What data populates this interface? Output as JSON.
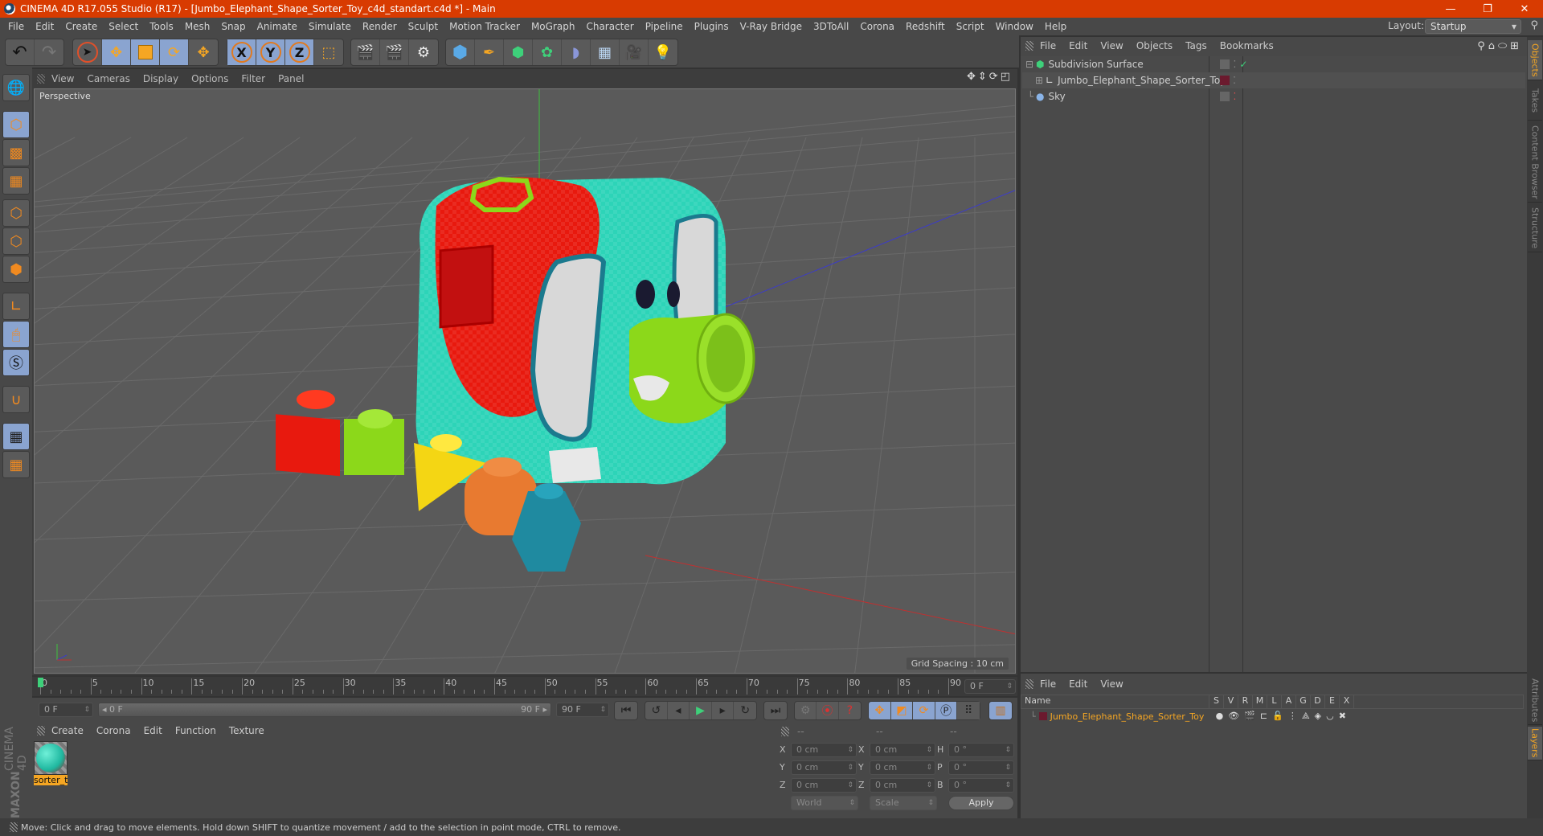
{
  "window": {
    "title": "CINEMA 4D R17.055 Studio (R17) - [Jumbo_Elephant_Shape_Sorter_Toy_c4d_standart.c4d *] - Main",
    "minimize": "—",
    "restore": "❐",
    "close": "✕"
  },
  "menubar": {
    "items": [
      "File",
      "Edit",
      "Create",
      "Select",
      "Tools",
      "Mesh",
      "Snap",
      "Animate",
      "Simulate",
      "Render",
      "Sculpt",
      "Motion Tracker",
      "MoGraph",
      "Character",
      "Pipeline",
      "Plugins",
      "V-Ray Bridge",
      "3DToAll",
      "Corona",
      "Redshift",
      "Script",
      "Window",
      "Help"
    ],
    "layout_label": "Layout:",
    "layout_value": "Startup"
  },
  "toolbar": {
    "undo": "undo-icon",
    "redo": "redo-icon",
    "tools": [
      "live-selection",
      "move",
      "scale",
      "rotate",
      "last-used"
    ],
    "axis_x": "X",
    "axis_y": "Y",
    "axis_z": "Z",
    "coord_system": "world-coordinates",
    "render": [
      "render-view",
      "render-picture-viewer",
      "render-settings"
    ],
    "create": [
      "cube",
      "pen",
      "subdivision",
      "cloner",
      "deformer",
      "floor",
      "camera",
      "light"
    ]
  },
  "left_tools": [
    "make-editable",
    "model-mode",
    "texture-mode",
    "workplane-mode",
    "points-mode",
    "edges-mode",
    "polygons-mode",
    "axis-mode",
    "tweak-mode",
    "solo-mode",
    "snap",
    "lock-workplane",
    "planar-workplane"
  ],
  "viewport": {
    "menu": [
      "View",
      "Cameras",
      "Display",
      "Options",
      "Filter",
      "Panel"
    ],
    "label": "Perspective",
    "grid_spacing": "Grid Spacing : 10 cm",
    "axis_y": "y",
    "axis_z": "z"
  },
  "timeline": {
    "ticks": [
      "0",
      "5",
      "10",
      "15",
      "20",
      "25",
      "30",
      "35",
      "40",
      "45",
      "50",
      "55",
      "60",
      "65",
      "70",
      "75",
      "80",
      "85",
      "90"
    ],
    "current_frame": "0 F",
    "start_field": "0 F",
    "range_start": "0 F",
    "range_end": "90 F",
    "end_field": "90 F",
    "playhead_fraction": 0
  },
  "materials": {
    "menu": [
      "Create",
      "Corona",
      "Edit",
      "Function",
      "Texture"
    ],
    "items": [
      {
        "name": "sorter_t"
      }
    ],
    "brand_top": "MAXON",
    "brand_bottom": "CINEMA 4D"
  },
  "coords": {
    "headers": [
      "--",
      "--",
      "--"
    ],
    "rows": [
      {
        "a": "X",
        "av": "0 cm",
        "b": "X",
        "bv": "0 cm",
        "c": "H",
        "cv": "0 °"
      },
      {
        "a": "Y",
        "av": "0 cm",
        "b": "Y",
        "bv": "0 cm",
        "c": "P",
        "cv": "0 °"
      },
      {
        "a": "Z",
        "av": "0 cm",
        "b": "Z",
        "bv": "0 cm",
        "c": "B",
        "cv": "0 °"
      }
    ],
    "space": "World",
    "mode": "Scale",
    "apply": "Apply"
  },
  "object_manager": {
    "menu": [
      "File",
      "Edit",
      "View",
      "Objects",
      "Tags",
      "Bookmarks"
    ],
    "objects": [
      {
        "name": "Subdivision Surface",
        "indent": 0
      },
      {
        "name": "Jumbo_Elephant_Shape_Sorter_Toy",
        "indent": 1
      },
      {
        "name": "Sky",
        "indent": 0
      }
    ]
  },
  "layer_manager": {
    "menu": [
      "File",
      "Edit",
      "View"
    ],
    "columns": [
      "Name",
      "S",
      "V",
      "R",
      "M",
      "L",
      "A",
      "G",
      "D",
      "E",
      "X"
    ],
    "layers": [
      {
        "name": "Jumbo_Elephant_Shape_Sorter_Toy",
        "color": "#6b1a2e"
      }
    ]
  },
  "right_tabs": {
    "top": [
      "Objects",
      "Takes",
      "Content Browser",
      "Structure"
    ],
    "bottom": [
      "Attributes",
      "Layers"
    ]
  },
  "status": "Move: Click and drag to move elements. Hold down SHIFT to quantize movement / add to the selection in point mode, CTRL to remove.",
  "colors": {
    "title_bar": "#d83b01",
    "accent": "#f5a623",
    "selected_tool": "#8aa4d0"
  }
}
